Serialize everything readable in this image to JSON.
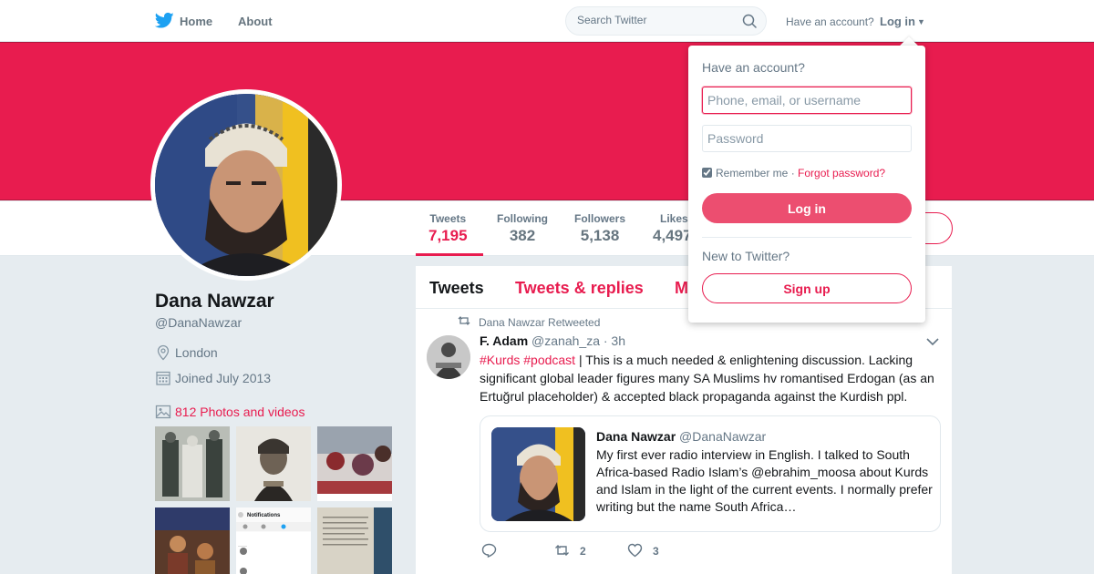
{
  "nav": {
    "home_label": "Home",
    "about_label": "About",
    "search_placeholder": "Search Twitter",
    "have_account": "Have an account?",
    "login_label": "Log in"
  },
  "colors": {
    "accent": "#e81c4f",
    "text_secondary": "#657786",
    "background": "#e6ecf0"
  },
  "stats": [
    {
      "label": "Tweets",
      "value": "7,195"
    },
    {
      "label": "Following",
      "value": "382"
    },
    {
      "label": "Followers",
      "value": "5,138"
    },
    {
      "label": "Likes",
      "value": "4,497"
    }
  ],
  "profile": {
    "name": "Dana Nawzar",
    "handle": "@DanaNawzar",
    "location": "London",
    "joined": "Joined July 2013",
    "photos_link": "812 Photos and videos"
  },
  "timeline": {
    "tabs": [
      "Tweets",
      "Tweets & replies",
      "Media"
    ],
    "tweet": {
      "retweet_context": "Dana Nawzar Retweeted",
      "author_name": "F. Adam",
      "author_handle": "@zanah_za",
      "time": "· 3h",
      "hashtag1": "#Kurds",
      "hashtag2": "#podcast",
      "text": " | This is a much needed & enlightening discussion. Lacking significant global leader figures many SA Muslims hv romantised Erdogan (as an Ertuğrul placeholder) & accepted black propaganda against the Kurdish ppl.",
      "quote": {
        "author_name": "Dana Nawzar",
        "author_handle": "@DanaNawzar",
        "text": "My first ever radio interview in English. I talked to South Africa-based Radio Islam’s @ebrahim_moosa about Kurds and Islam in the light of the current events. I normally prefer writing but the name South Africa…"
      },
      "retweet_count": "2",
      "like_count": "3"
    }
  },
  "login_dropdown": {
    "title": "Have an account?",
    "username_placeholder": "Phone, email, or username",
    "password_placeholder": "Password",
    "remember_me": "Remember me",
    "separator": " · ",
    "forgot_password": "Forgot password?",
    "login_button": "Log in",
    "new_to_twitter": "New to Twitter?",
    "signup_button": "Sign up"
  },
  "icons": {
    "logo": "twitter-bird-icon",
    "search": "search-icon",
    "location": "location-pin-icon",
    "calendar": "calendar-icon",
    "photos": "photo-icon",
    "retweet": "retweet-icon",
    "reply": "reply-icon",
    "like": "heart-icon",
    "caret": "chevron-down-icon"
  }
}
